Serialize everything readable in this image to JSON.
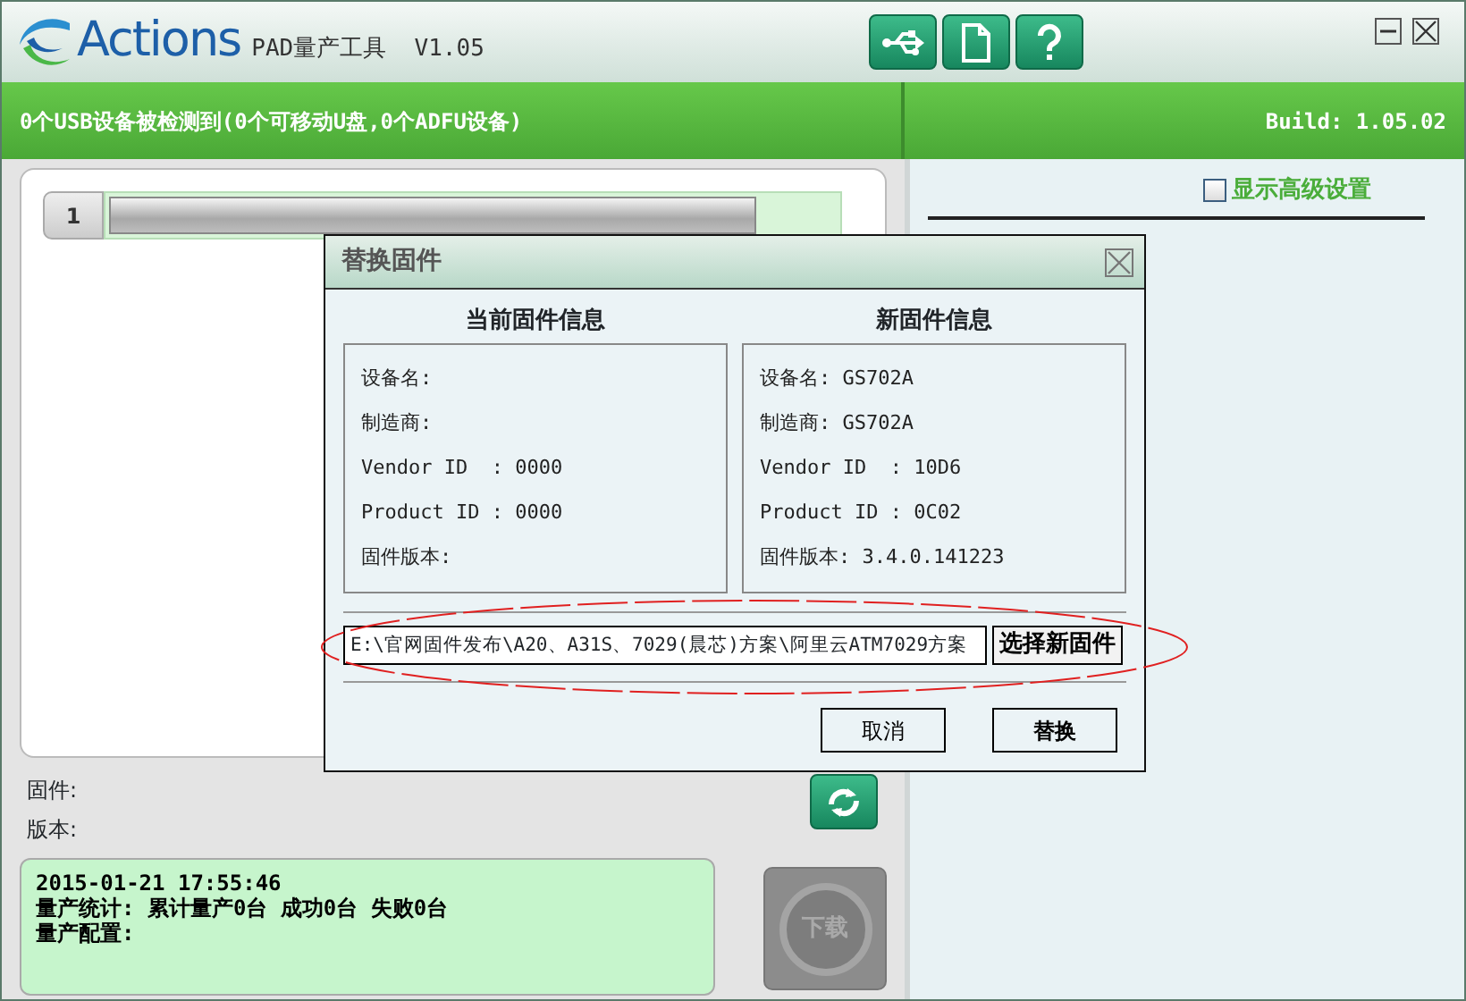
{
  "app": {
    "logo": "Actions",
    "title": "PAD量产工具  V1.05"
  },
  "status_bar": {
    "message": "0个USB设备被检测到(0个可移动U盘,0个ADFU设备)",
    "build": "Build: 1.05.02"
  },
  "slots": [
    {
      "number": "1",
      "level": 0.89
    }
  ],
  "firmware_label": "固件:",
  "version_label": "版本:",
  "log": [
    "2015-01-21 17:55:46",
    "量产统计: 累计量产0台 成功0台 失败0台",
    "量产配置:"
  ],
  "download_button": {
    "label": "下载",
    "disabled": true
  },
  "options": [
    {
      "kind": "highlight",
      "label": "显示高级设置",
      "checked": false
    }
  ],
  "dialog": {
    "title": "替换固件",
    "panels": [
      {
        "heading": "当前固件信息",
        "lines": [
          "设备名:",
          "制造商:",
          "Vendor ID  : 0000",
          "Product ID : 0000",
          "固件版本:"
        ]
      },
      {
        "heading": "新固件信息",
        "lines": [
          "设备名: GS702A",
          "制造商: GS702A",
          "Vendor ID  : 10D6",
          "Product ID : 0C02",
          "固件版本: 3.4.0.141223"
        ]
      }
    ],
    "path": "E:\\官网固件发布\\A20、A31S、7029(晨芯)方案\\阿里云ATM7029方案",
    "select_button": "选择新固件",
    "buttons": [
      "取消",
      "替换"
    ]
  }
}
